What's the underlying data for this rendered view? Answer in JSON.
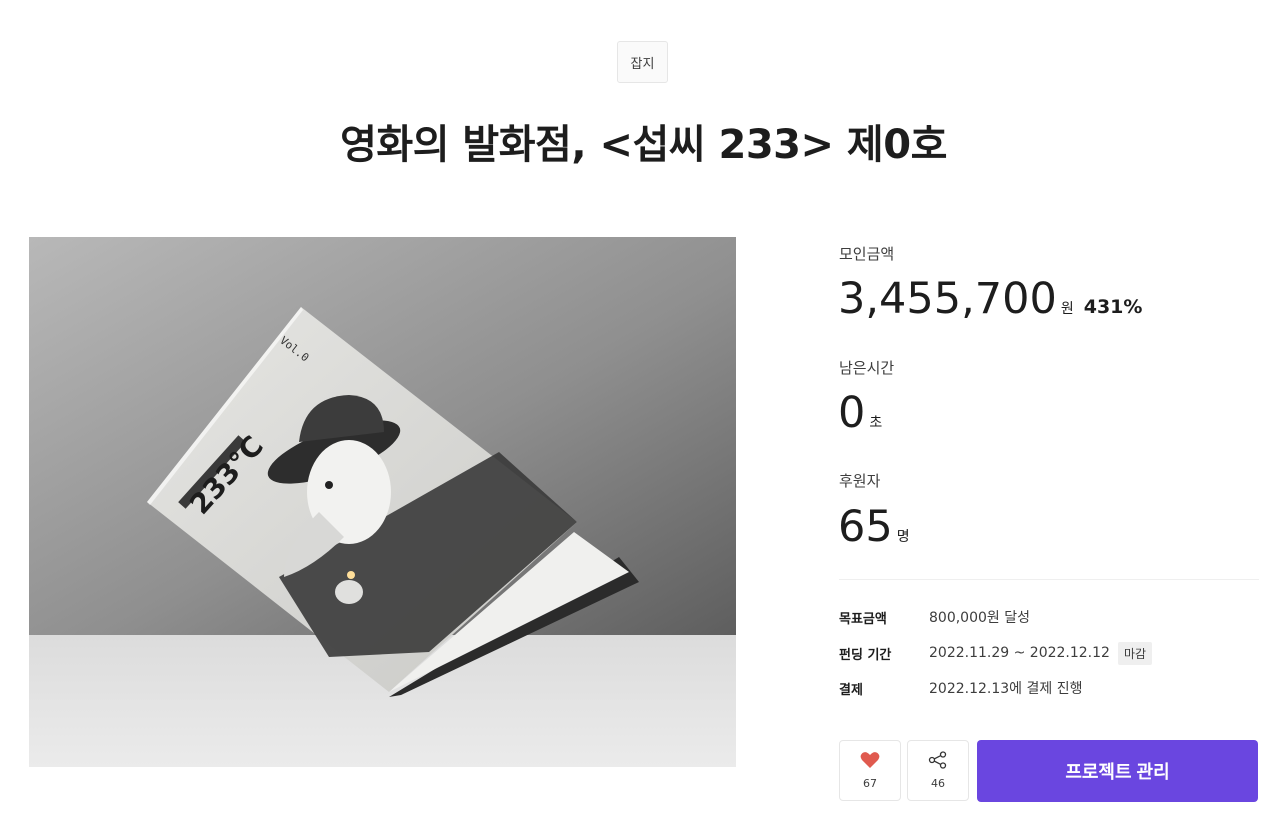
{
  "category": "잡지",
  "title": "영화의 발화점, <섭씨 233> 제0호",
  "cover": {
    "logo": "233°C",
    "volume": "Vol.0"
  },
  "stats": {
    "raised": {
      "label": "모인금액",
      "value": "3,455,700",
      "unit": "원",
      "percent": "431%"
    },
    "time_left": {
      "label": "남은시간",
      "value": "0",
      "unit": "초"
    },
    "backers": {
      "label": "후원자",
      "value": "65",
      "unit": "명"
    }
  },
  "info": {
    "goal": {
      "key": "목표금액",
      "value": "800,000원 달성"
    },
    "period": {
      "key": "펀딩 기간",
      "value": "2022.11.29 ~ 2022.12.12",
      "tag": "마감"
    },
    "payment": {
      "key": "결제",
      "value": "2022.12.13에 결제 진행"
    }
  },
  "actions": {
    "like_count": "67",
    "share_count": "46",
    "manage_label": "프로젝트 관리"
  },
  "colors": {
    "accent": "#6a46e0",
    "heart": "#e05a4f"
  },
  "icons": {
    "like": "heart-icon",
    "share": "share-icon"
  }
}
